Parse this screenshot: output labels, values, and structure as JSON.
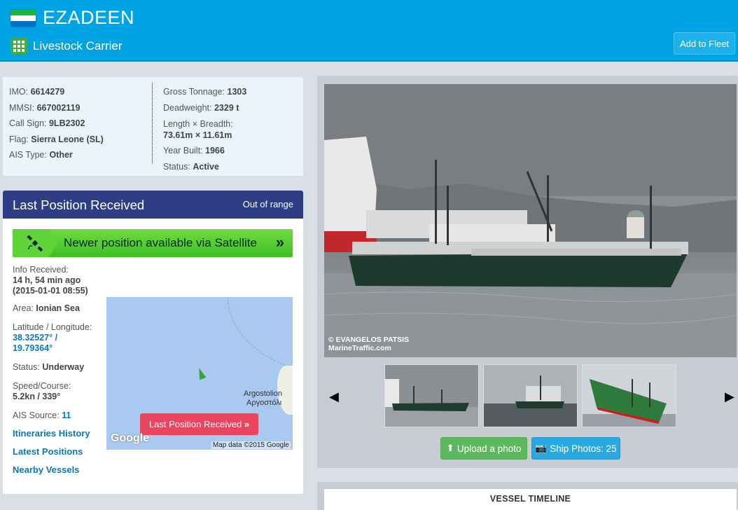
{
  "header": {
    "vessel_name": "EZADEEN",
    "vessel_type": "Livestock Carrier",
    "add_to_fleet_label": "Add to Fleet",
    "flag_colors": [
      "#1eb53a",
      "#ffffff",
      "#0072c6"
    ]
  },
  "particulars": {
    "left": [
      {
        "label": "IMO:",
        "value": "6614279"
      },
      {
        "label": "MMSI:",
        "value": "667002119"
      },
      {
        "label": "Call Sign:",
        "value": "9LB2302"
      },
      {
        "label": "Flag:",
        "value": "Sierra Leone (SL)"
      },
      {
        "label": "AIS Type:",
        "value": "Other"
      }
    ],
    "right": [
      {
        "label": "Gross Tonnage:",
        "value": "1303"
      },
      {
        "label": "Deadweight:",
        "value": "2329 t"
      },
      {
        "label": "Length × Breadth:",
        "value": "73.61m × 11.61m"
      },
      {
        "label": "Year Built:",
        "value": "1966"
      },
      {
        "label": "Status:",
        "value": "Active"
      }
    ]
  },
  "position": {
    "title": "Last Position Received",
    "range_status": "Out of range",
    "satellite_banner": "Newer position available via Satellite",
    "info_received_label": "Info Received:",
    "info_received_ago": "14 h, 54 min ago",
    "info_received_time": "(2015-01-01 08:55)",
    "area_label": "Area:",
    "area_value": "Ionian Sea",
    "latlon_label": "Latitude / Longitude:",
    "lat": "38.32527° /",
    "lon": "19.79364°",
    "status_label": "Status:",
    "status_value": "Underway",
    "speed_label": "Speed/Course:",
    "speed_value": "5.2kn / 339°",
    "ais_source_label": "AIS Source:",
    "ais_source_value": "11",
    "links": [
      "Itineraries History",
      "Latest Positions",
      "Nearby Vessels"
    ]
  },
  "map": {
    "place_latin": "Argostolion",
    "place_greek": "Αργοστόλι",
    "last_position_button": "Last Position Received",
    "google_logo": "Google",
    "credit": "Map data ©2015 Google"
  },
  "photos": {
    "credit_line1": "© EVANGELOS PATSIS",
    "credit_line2": "MarineTraffic.com",
    "upload_label": "Upload a photo",
    "ship_photos_label": "Ship Photos: 25"
  },
  "timeline": {
    "title": "VESSEL TIMELINE"
  }
}
